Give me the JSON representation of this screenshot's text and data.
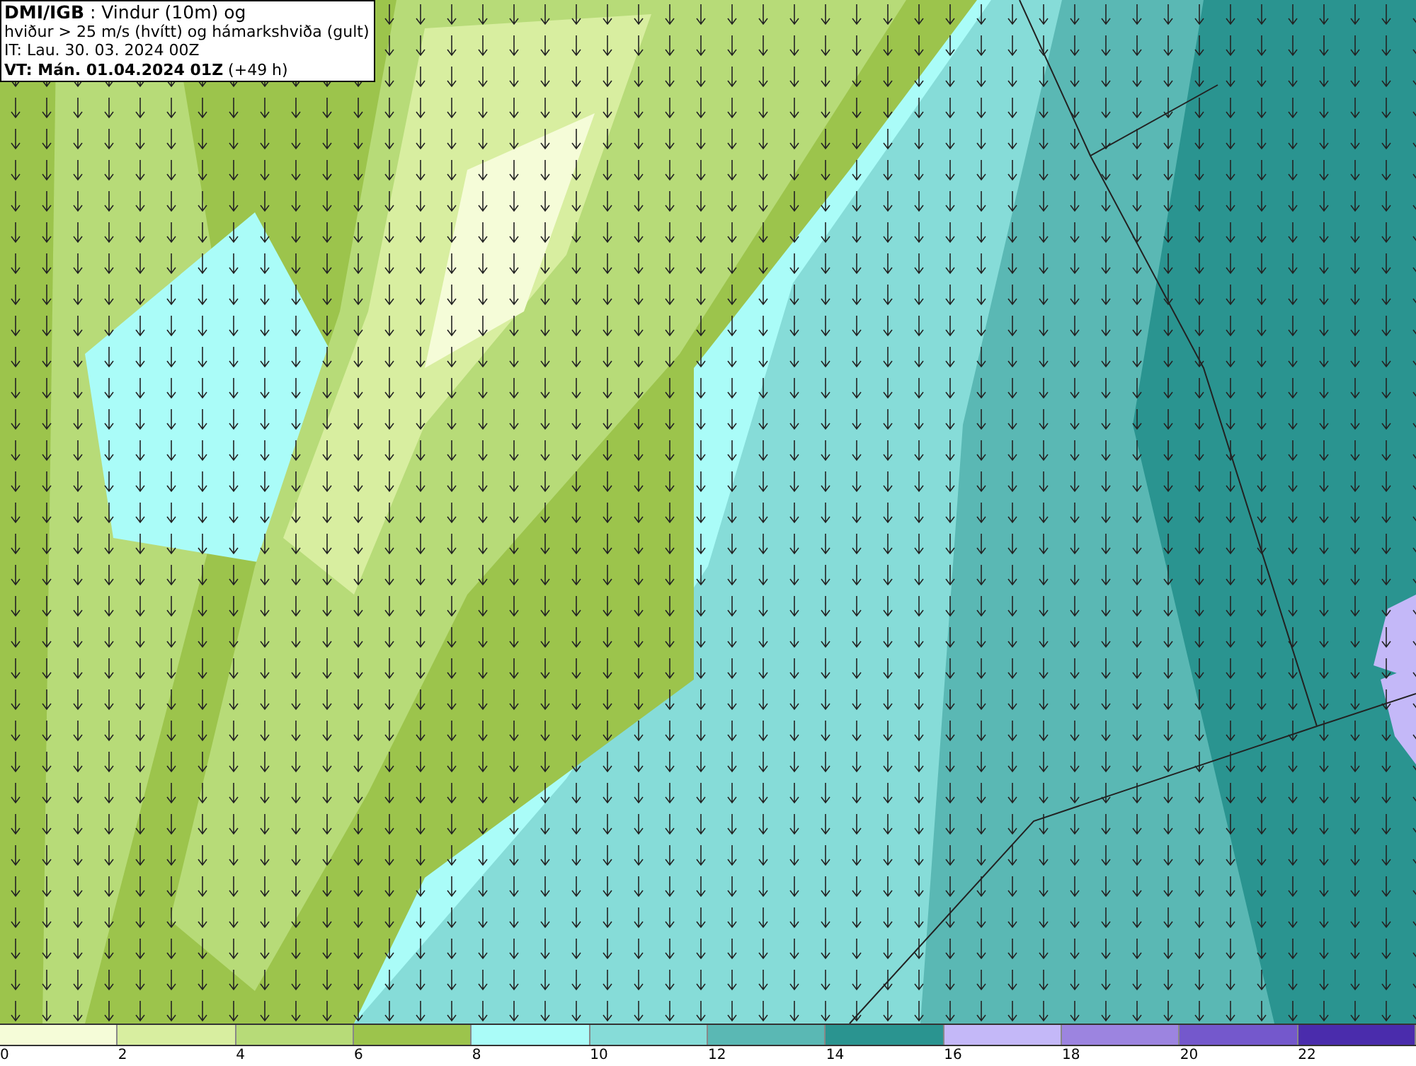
{
  "title": {
    "lines": [
      "**DMI/IGB** : Vindur (10m) og",
      "hviður > 25 m/s (hvítt) og hámarkshviða (gult)",
      "IT: Lau. 30. 03. 2024 00Z",
      "**VT: Mán. 01.04.2024 01Z** (+49 h)"
    ]
  },
  "legend": {
    "swatches": [
      {
        "color": "#f5fcd8"
      },
      {
        "color": "#d8eea0"
      },
      {
        "color": "#b7db78"
      },
      {
        "color": "#9cc44c"
      },
      {
        "color": "#aafcf8"
      },
      {
        "color": "#86dcd8"
      },
      {
        "color": "#5ab8b4"
      },
      {
        "color": "#2a9490"
      },
      {
        "color": "#c4b8f8"
      },
      {
        "color": "#9c84e0"
      },
      {
        "color": "#7458cc"
      },
      {
        "color": "#4a2cac"
      }
    ],
    "labels": [
      "0",
      "2",
      "4",
      "6",
      "8",
      "10",
      "12",
      "14",
      "16",
      "18",
      "20",
      "22"
    ]
  }
}
